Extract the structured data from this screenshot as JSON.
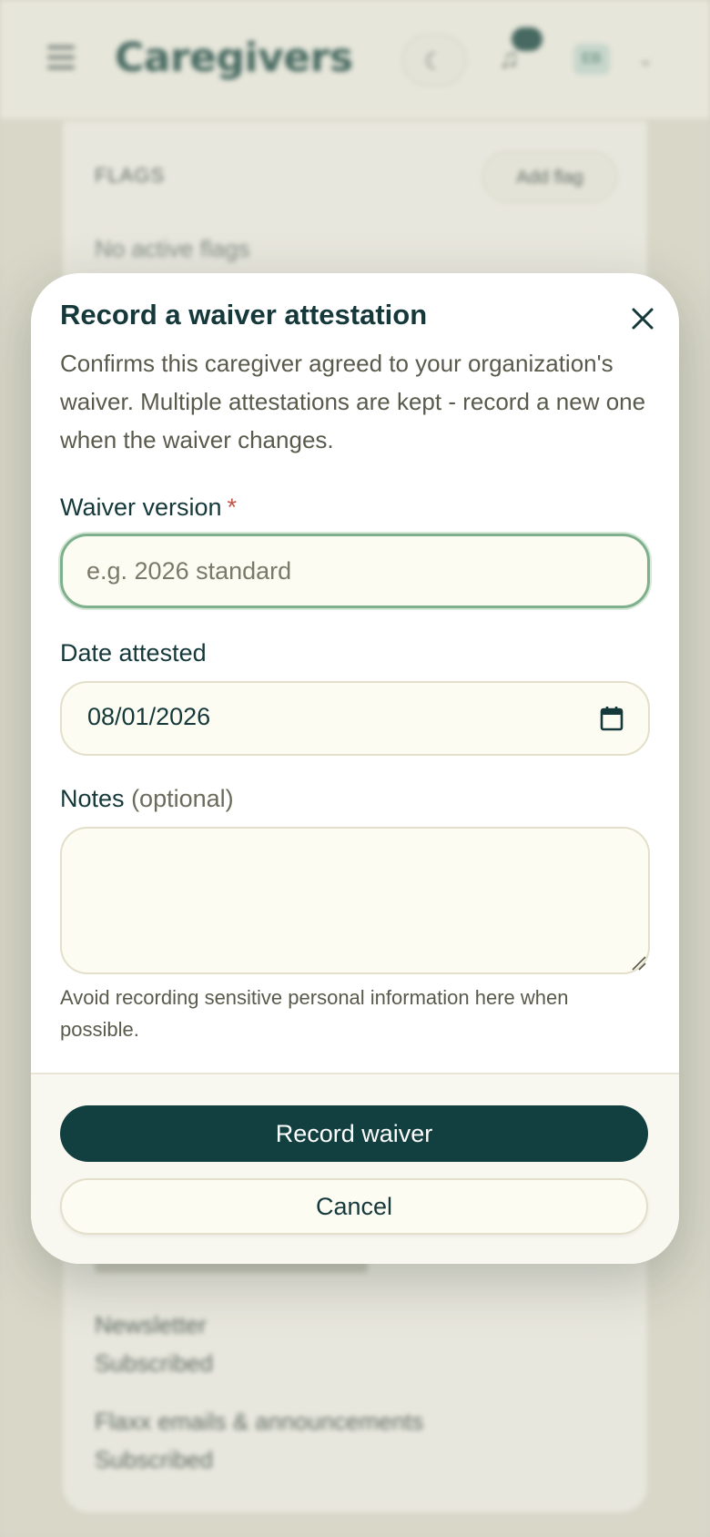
{
  "background": {
    "page_title": "Caregivers",
    "avatar_initials": "EB",
    "flags_label": "FLAGS",
    "add_flag_label": "Add flag",
    "no_flags_text": "No active flags",
    "rows": [
      {
        "label": "Newsletter",
        "value": "Subscribed"
      },
      {
        "label": "Flaxx emails & announcements",
        "value": "Subscribed"
      }
    ]
  },
  "modal": {
    "title": "Record a waiver attestation",
    "description": "Confirms this caregiver agreed to your organization's waiver. Multiple attestations are kept - record a new one when the waiver changes.",
    "waiver_version": {
      "label": "Waiver version",
      "required_mark": "*",
      "value": "",
      "placeholder": "e.g. 2026 standard"
    },
    "date_attested": {
      "label": "Date attested",
      "value": "08/01/2026"
    },
    "notes": {
      "label": "Notes",
      "optional_text": "(optional)",
      "value": "",
      "help_text": "Avoid recording sensitive personal information here when possible."
    },
    "primary_button": "Record waiver",
    "cancel_button": "Cancel"
  },
  "colors": {
    "primary": "#123f3f",
    "required": "#c0554a",
    "focus_border": "#7fb08e",
    "field_bg": "#fdfcf3"
  },
  "icons": {
    "close": "close-icon",
    "calendar": "calendar-icon",
    "menu": "hamburger-icon",
    "theme": "moon-icon",
    "notifications": "bell-icon"
  }
}
